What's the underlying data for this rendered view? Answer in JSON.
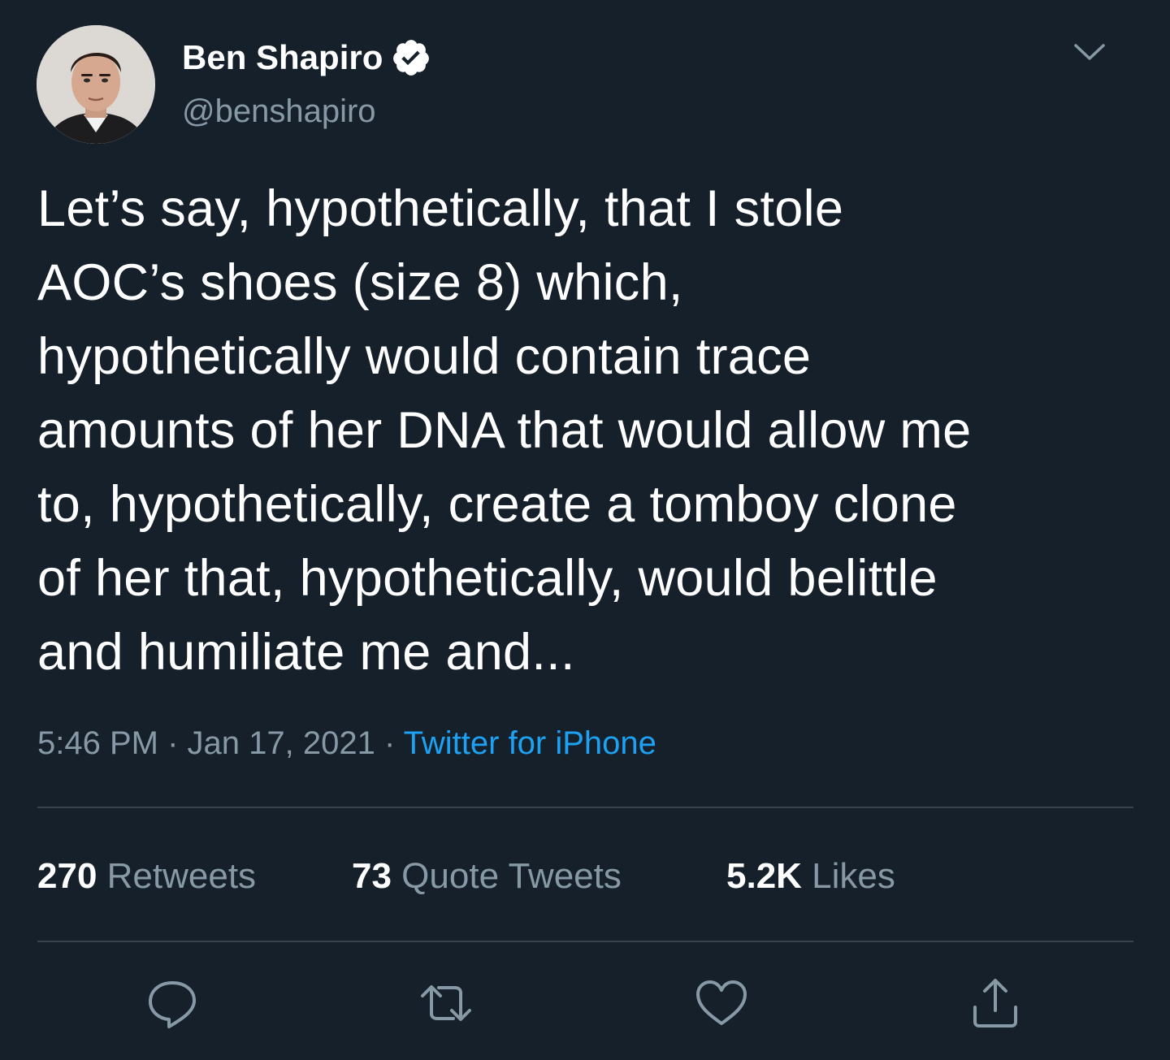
{
  "tweet": {
    "author": {
      "display_name": "Ben Shapiro",
      "handle": "@benshapiro",
      "verified": true,
      "avatar_icon": "profile-photo"
    },
    "text": "Let’s say, hypothetically, that I stole\nAOC’s shoes (size 8) which,\nhypothetically would contain trace\namounts of her DNA that would allow me\nto, hypothetically, create a tomboy clone\nof her that, hypothetically, would belittle\nand humiliate me and...",
    "time": "5:46 PM",
    "date": "Jan 17, 2021",
    "separator": " · ",
    "source": "Twitter for iPhone",
    "stats": {
      "retweets": {
        "count": "270",
        "label": " Retweets"
      },
      "quote_tweets": {
        "count": "73",
        "label": " Quote Tweets"
      },
      "likes": {
        "count": "5.2K",
        "label": " Likes"
      }
    },
    "actions": [
      "reply-icon",
      "retweet-icon",
      "like-icon",
      "share-icon"
    ]
  },
  "colors": {
    "background": "#15202b",
    "primary_text": "#ffffff",
    "secondary_text": "#8899a6",
    "accent": "#1da1f2",
    "divider": "#38444d"
  }
}
